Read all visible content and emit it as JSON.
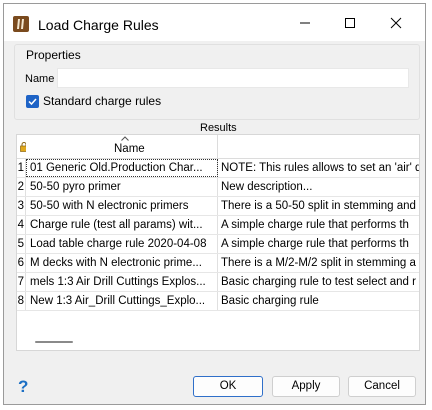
{
  "window": {
    "title": "Load Charge Rules"
  },
  "properties": {
    "group_label": "Properties",
    "name_label": "Name",
    "name_value": "",
    "standard_rules_label": "Standard charge rules",
    "standard_rules_checked": true
  },
  "results": {
    "label": "Results",
    "columns": {
      "name": "Name",
      "description": ""
    },
    "rows": [
      {
        "idx": "1",
        "name": "01 Generic Old.Production Char...",
        "description": "NOTE: This rules allows to set an 'air' d"
      },
      {
        "idx": "2",
        "name": "50-50 pyro primer",
        "description": "New description..."
      },
      {
        "idx": "3",
        "name": "50-50 with N electronic primers",
        "description": "There is a 50-50 split in stemming and"
      },
      {
        "idx": "4",
        "name": "Charge rule (test all params) wit...",
        "description": "A simple charge rule that performs th"
      },
      {
        "idx": "5",
        "name": "Load table charge rule 2020-04-08",
        "description": "A simple charge rule that performs th"
      },
      {
        "idx": "6",
        "name": "M decks with N electronic prime...",
        "description": "There is a M/2-M/2 split in stemming a"
      },
      {
        "idx": "7",
        "name": "mels 1:3 Air Drill Cuttings Explos...",
        "description": "Basic charging rule to test select and r"
      },
      {
        "idx": "8",
        "name": "New 1:3 Air_Drill Cuttings_Explo...",
        "description": "Basic charging rule"
      }
    ]
  },
  "buttons": {
    "ok": "OK",
    "apply": "Apply",
    "cancel": "Cancel"
  },
  "icons": {
    "app": "load-charge-app-icon",
    "help": "help-icon",
    "lock": "lock-icon"
  },
  "colors": {
    "accent": "#1e63c6",
    "help": "#1c6fc4"
  }
}
